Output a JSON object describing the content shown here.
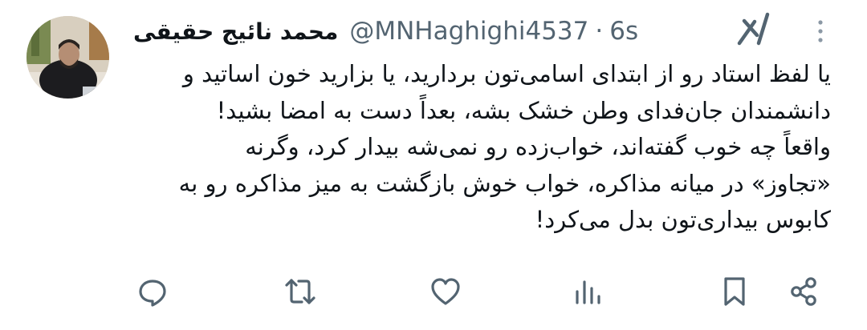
{
  "tweet": {
    "author": {
      "display_name": "محمد نائیج حقیقی",
      "handle": "@MNHaghighi4537",
      "separator": "·",
      "time": "6s"
    },
    "text_lines": [
      "یا لفظ استاد رو از ابتدای اسامی‌تون بردارید، یا بزارید خون اساتید و",
      "دانشمندان جان‌فدای وطن خشک بشه، بعداً دست به امضا بشید!",
      "واقعاً چه خوب گفته‌اند، خواب‌زده رو نمی‌شه بیدار کرد، وگرنه",
      "«تجاوز» در میانه مذاکره، خواب خوش بازگشت به میز مذاکره رو به",
      "کابوس بیداری‌تون بدل می‌کرد!"
    ]
  },
  "actions": [
    {
      "icon": "reply-icon"
    },
    {
      "icon": "retweet-icon"
    },
    {
      "icon": "like-icon"
    },
    {
      "icon": "views-icon"
    },
    {
      "icon": "bookmark-icon"
    },
    {
      "icon": "share-icon"
    }
  ],
  "colors": {
    "text": "#0f1419",
    "secondary": "#536471"
  }
}
